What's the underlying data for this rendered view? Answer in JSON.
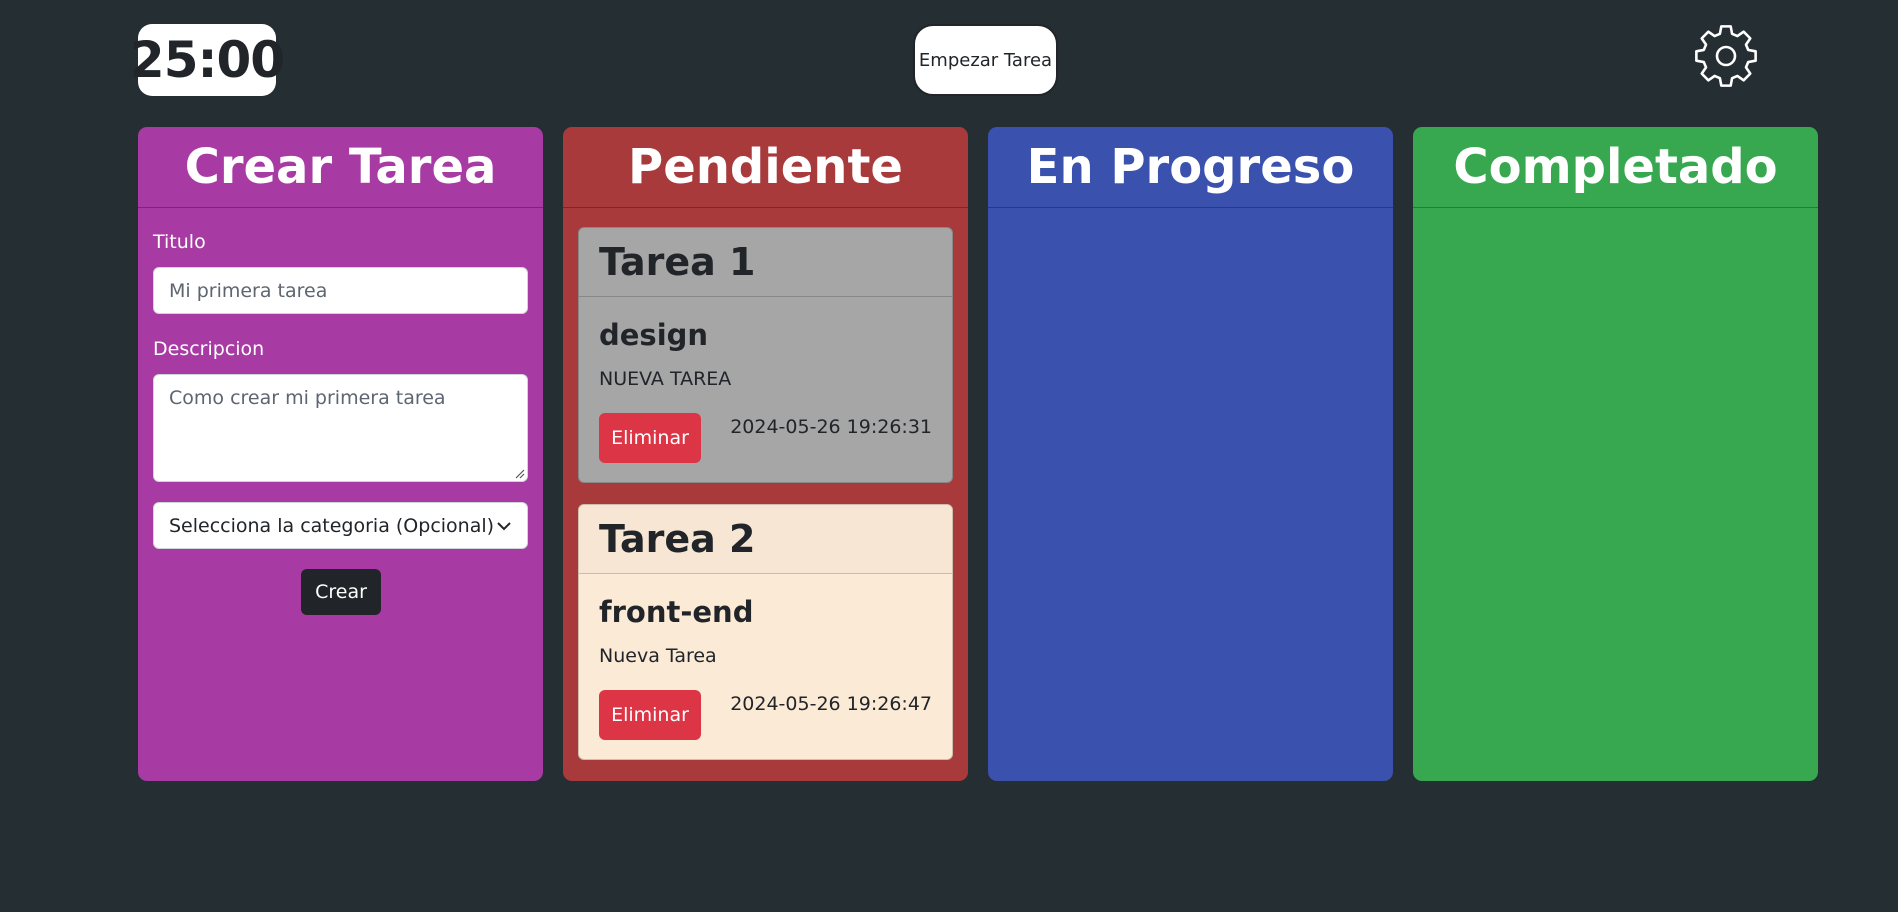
{
  "colors": {
    "background": "#252e33",
    "crear": "#a73aa3",
    "pendiente": "#a83a3c",
    "progreso": "#3a51ae",
    "completado": "#38a850",
    "card1": "#a6a6a6",
    "card1_head": "#a6a6a6",
    "card2": "#fbebd6",
    "card2_head": "#f6e6d3",
    "danger": "#dc3545"
  },
  "header": {
    "timer": "25:00",
    "start_label": "Empezar Tarea",
    "settings_icon": "gear-icon"
  },
  "columns": {
    "crear": "Crear Tarea",
    "pendiente": "Pendiente",
    "progreso": "En Progreso",
    "completado": "Completado"
  },
  "form": {
    "titulo_label": "Titulo",
    "titulo_placeholder": "Mi primera tarea",
    "descripcion_label": "Descripcion",
    "descripcion_placeholder": "Como crear mi primera tarea",
    "categoria_selected": "Selecciona la categoria (Opcional)",
    "crear_label": "Crear"
  },
  "tasks": [
    {
      "title": "Tarea 1",
      "category": "design",
      "description": "NUEVA TAREA",
      "delete_label": "Eliminar",
      "date": "2024-05-26 19:26:31"
    },
    {
      "title": "Tarea 2",
      "category": "front-end",
      "description": "Nueva Tarea",
      "delete_label": "Eliminar",
      "date": "2024-05-26 19:26:47"
    }
  ]
}
